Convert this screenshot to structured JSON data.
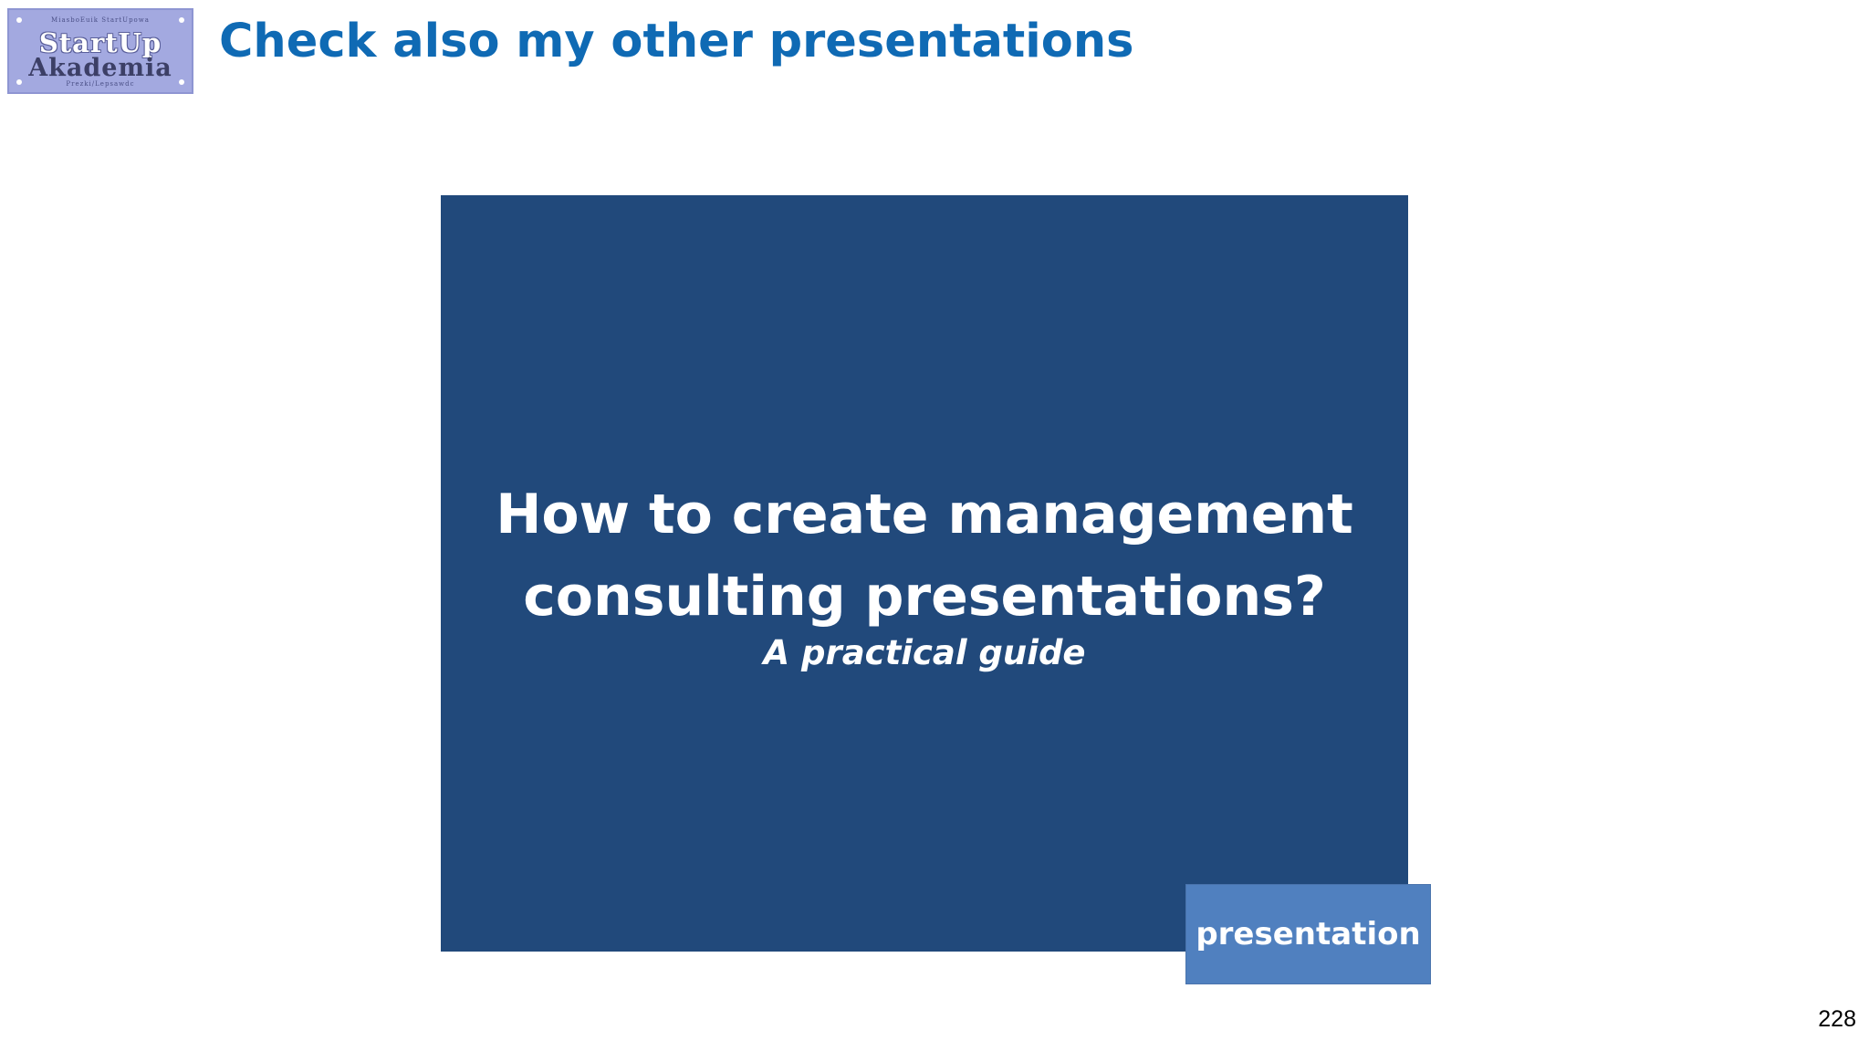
{
  "logo": {
    "line_top": "MiasboEuik StartUpowa",
    "word_1": "StartUp",
    "word_2": "Akademia",
    "line_bottom": "Prezki/Lepsawdc"
  },
  "header": {
    "title": "Check also my other presentations"
  },
  "thumbnail": {
    "title_line_1": "How to create management",
    "title_line_2": "consulting presentations?",
    "subtitle": "A practical guide",
    "tag_label": "presentation"
  },
  "footer": {
    "page_number": "228"
  },
  "colors": {
    "title_blue": "#0f6ab4",
    "card_navy": "#21497b",
    "tag_blue": "#5080bf",
    "logo_lavender": "#a3a9e0"
  }
}
